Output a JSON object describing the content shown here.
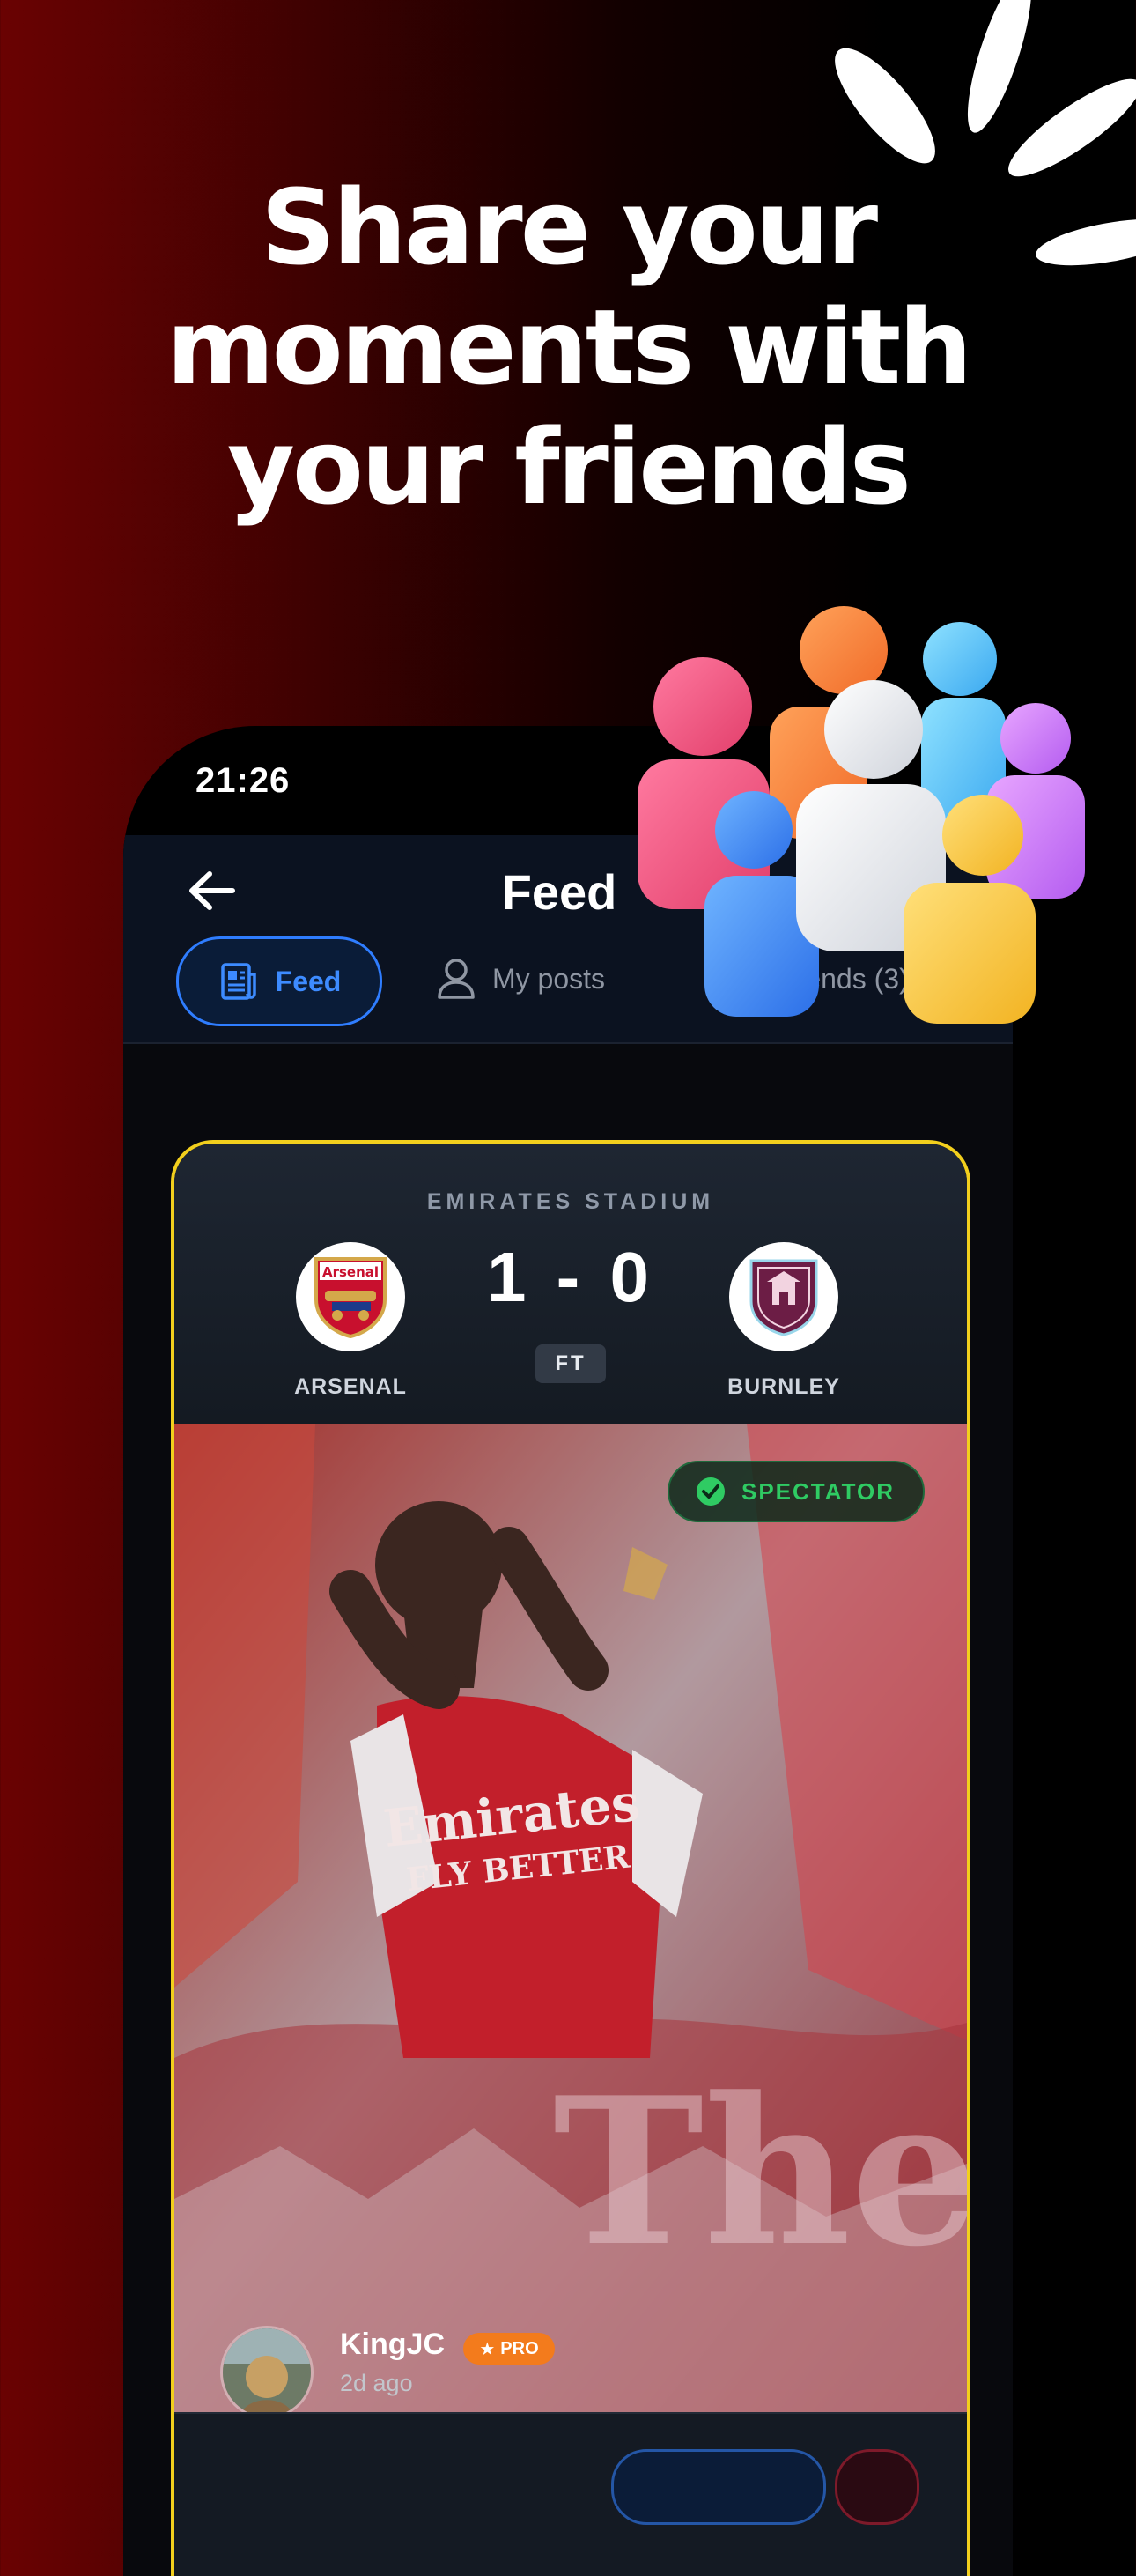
{
  "headline": {
    "line1": "Share your",
    "line2": "moments with",
    "line3": "your friends"
  },
  "status_bar": {
    "time": "21:26"
  },
  "header": {
    "title": "Feed",
    "back_icon": "arrow-left-icon"
  },
  "tabs": [
    {
      "label": "Feed",
      "icon": "newspaper-icon",
      "active": true
    },
    {
      "label": "My posts",
      "icon": "user-icon",
      "active": false
    },
    {
      "label": "Friends (3)",
      "icon": "users-icon",
      "active": false
    }
  ],
  "post": {
    "stadium": "EMIRATES STADIUM",
    "home_team": "ARSENAL",
    "home_crest_text": "Arsenal",
    "away_team": "BURNLEY",
    "score": "1 - 0",
    "status": "FT",
    "badge": "SPECTATOR",
    "username": "KingJC",
    "pro_label": "PRO",
    "time_ago": "2d ago"
  },
  "colors": {
    "accent_blue": "#2f7dff",
    "card_border": "#f2cf1d",
    "spectator_green": "#2fcb63",
    "pro_orange": "#f37b1c",
    "bg_red": "#6a0202"
  }
}
